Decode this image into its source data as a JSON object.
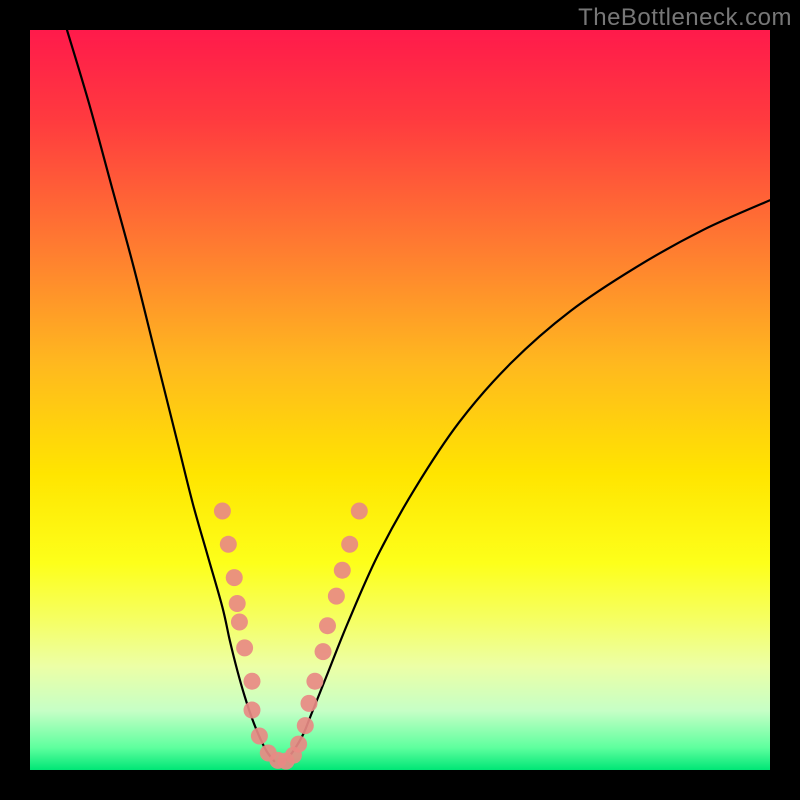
{
  "watermark": "TheBottleneck.com",
  "chart_data": {
    "type": "line",
    "title": "",
    "xlabel": "",
    "ylabel": "",
    "xlim": [
      0,
      100
    ],
    "ylim": [
      0,
      100
    ],
    "grid": false,
    "legend": false,
    "background_gradient": {
      "stops": [
        {
          "offset": 0.0,
          "color": "#ff1a4b"
        },
        {
          "offset": 0.12,
          "color": "#ff3a3f"
        },
        {
          "offset": 0.3,
          "color": "#ff7e30"
        },
        {
          "offset": 0.45,
          "color": "#ffb81f"
        },
        {
          "offset": 0.6,
          "color": "#ffe500"
        },
        {
          "offset": 0.72,
          "color": "#fdff1a"
        },
        {
          "offset": 0.8,
          "color": "#f5ff66"
        },
        {
          "offset": 0.86,
          "color": "#ecffa6"
        },
        {
          "offset": 0.92,
          "color": "#c6ffc6"
        },
        {
          "offset": 0.97,
          "color": "#5eff9e"
        },
        {
          "offset": 1.0,
          "color": "#00e676"
        }
      ]
    },
    "series": [
      {
        "name": "left-curve",
        "color": "#000000",
        "x": [
          5,
          8,
          11,
          14,
          17,
          20,
          22,
          24,
          26,
          27,
          28,
          29,
          30,
          31,
          32,
          33
        ],
        "y": [
          100,
          90,
          79,
          68,
          56,
          44,
          36,
          29,
          22,
          17.5,
          13.5,
          10,
          7,
          4.5,
          2.5,
          1.2
        ]
      },
      {
        "name": "right-curve",
        "color": "#000000",
        "x": [
          34,
          35,
          36,
          37,
          38,
          40,
          43,
          47,
          52,
          58,
          65,
          73,
          82,
          91,
          100
        ],
        "y": [
          1.0,
          1.8,
          3.2,
          5.0,
          7.5,
          12.5,
          20,
          29,
          38,
          47,
          55,
          62,
          68,
          73,
          77
        ]
      }
    ],
    "scatter": {
      "name": "highlight-points",
      "color": "#e88a84",
      "points": [
        {
          "x": 26.0,
          "y": 35.0
        },
        {
          "x": 26.8,
          "y": 30.5
        },
        {
          "x": 27.6,
          "y": 26.0
        },
        {
          "x": 28.0,
          "y": 22.5
        },
        {
          "x": 28.3,
          "y": 20.0
        },
        {
          "x": 29.0,
          "y": 16.5
        },
        {
          "x": 30.0,
          "y": 12.0
        },
        {
          "x": 30.0,
          "y": 8.1
        },
        {
          "x": 31.0,
          "y": 4.6
        },
        {
          "x": 32.2,
          "y": 2.3
        },
        {
          "x": 33.5,
          "y": 1.3
        },
        {
          "x": 34.6,
          "y": 1.2
        },
        {
          "x": 35.6,
          "y": 2.0
        },
        {
          "x": 36.3,
          "y": 3.5
        },
        {
          "x": 37.2,
          "y": 6.0
        },
        {
          "x": 37.7,
          "y": 9.0
        },
        {
          "x": 38.5,
          "y": 12.0
        },
        {
          "x": 39.6,
          "y": 16.0
        },
        {
          "x": 40.2,
          "y": 19.5
        },
        {
          "x": 41.4,
          "y": 23.5
        },
        {
          "x": 42.2,
          "y": 27.0
        },
        {
          "x": 43.2,
          "y": 30.5
        },
        {
          "x": 44.5,
          "y": 35.0
        }
      ]
    }
  }
}
